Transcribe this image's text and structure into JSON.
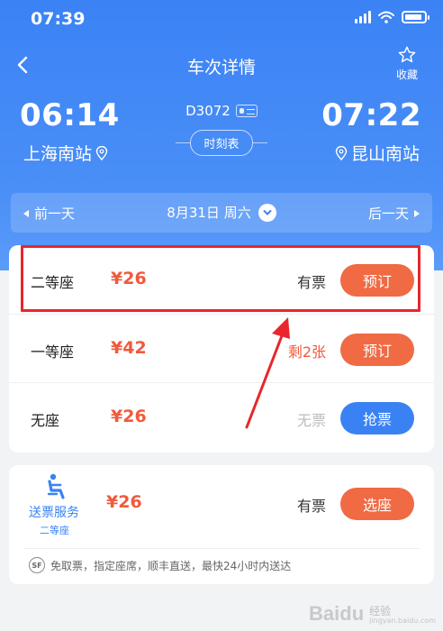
{
  "status_bar": {
    "time": "07:39"
  },
  "nav": {
    "title": "车次详情",
    "favorite_label": "收藏"
  },
  "train": {
    "number": "D3072",
    "departure_time": "06:14",
    "departure_station": "上海南站",
    "arrival_time": "07:22",
    "arrival_station": "昆山南站",
    "schedule_label": "时刻表"
  },
  "date_bar": {
    "prev_label": "前一天",
    "current_date": "8月31日 周六",
    "next_label": "后一天"
  },
  "seats": [
    {
      "name": "二等座",
      "price": "¥26",
      "stock": "有票",
      "action": "预订",
      "stock_color": "#333333",
      "action_color": "#f06a44"
    },
    {
      "name": "一等座",
      "price": "¥42",
      "stock": "剩2张",
      "action": "预订",
      "stock_color": "#f05a3c",
      "action_color": "#f06a44"
    },
    {
      "name": "无座",
      "price": "¥26",
      "stock": "无票",
      "action": "抢票",
      "stock_color": "#bbbbbb",
      "action_color": "#3a82f4"
    }
  ],
  "delivery": {
    "label": "送票服务",
    "sub_label": "二等座",
    "price": "¥26",
    "stock": "有票",
    "action": "选座",
    "note": "免取票，指定座席，顺丰直送，最快24小时内送达",
    "sf_icon_text": "SF"
  },
  "watermark": {
    "logo": "Baidu",
    "text": "经验",
    "sub": "jingyan.baidu.com"
  },
  "colors": {
    "primary_blue": "#3b82f5",
    "price_red": "#f05a3c",
    "book_orange": "#f06a44",
    "highlight_red": "#e8262b"
  }
}
